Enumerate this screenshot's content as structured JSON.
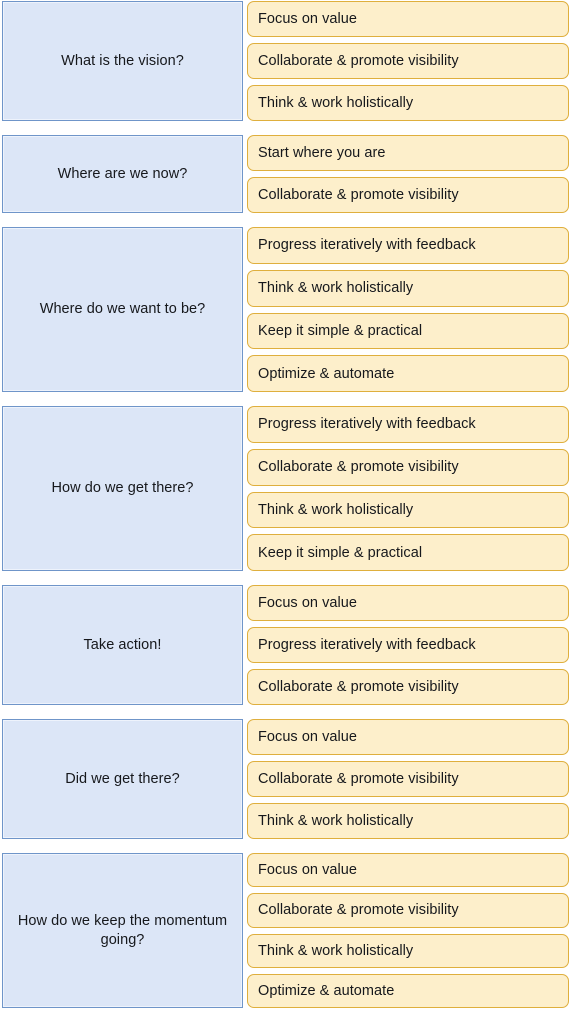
{
  "theme": {
    "question_fill": "#dce6f7",
    "question_border": "#6f95c9",
    "principle_fill": "#fdefcb",
    "principle_border": "#dfaf3d",
    "text_color": "#16181c",
    "page_background": "#ffffff"
  },
  "rows": [
    {
      "question": "What is the vision?",
      "principles": [
        "Focus on value",
        "Collaborate & promote visibility",
        "Think & work holistically"
      ]
    },
    {
      "question": "Where are we now?",
      "principles": [
        "Start where you are",
        "Collaborate & promote visibility"
      ]
    },
    {
      "question": "Where do we want to be?",
      "principles": [
        "Progress iteratively with feedback",
        "Think & work holistically",
        "Keep it simple & practical",
        "Optimize & automate"
      ]
    },
    {
      "question": "How do we get there?",
      "principles": [
        "Progress iteratively with feedback",
        "Collaborate & promote visibility",
        "Think & work holistically",
        "Keep it simple & practical"
      ]
    },
    {
      "question": "Take action!",
      "principles": [
        "Focus on value",
        "Progress iteratively with feedback",
        "Collaborate & promote visibility"
      ]
    },
    {
      "question": "Did we get there?",
      "principles": [
        "Focus on value",
        "Collaborate & promote visibility",
        "Think & work holistically"
      ]
    },
    {
      "question": "How do we keep the momentum going?",
      "principles": [
        "Focus on value",
        "Collaborate & promote visibility",
        "Think & work holistically",
        "Optimize & automate"
      ]
    }
  ]
}
